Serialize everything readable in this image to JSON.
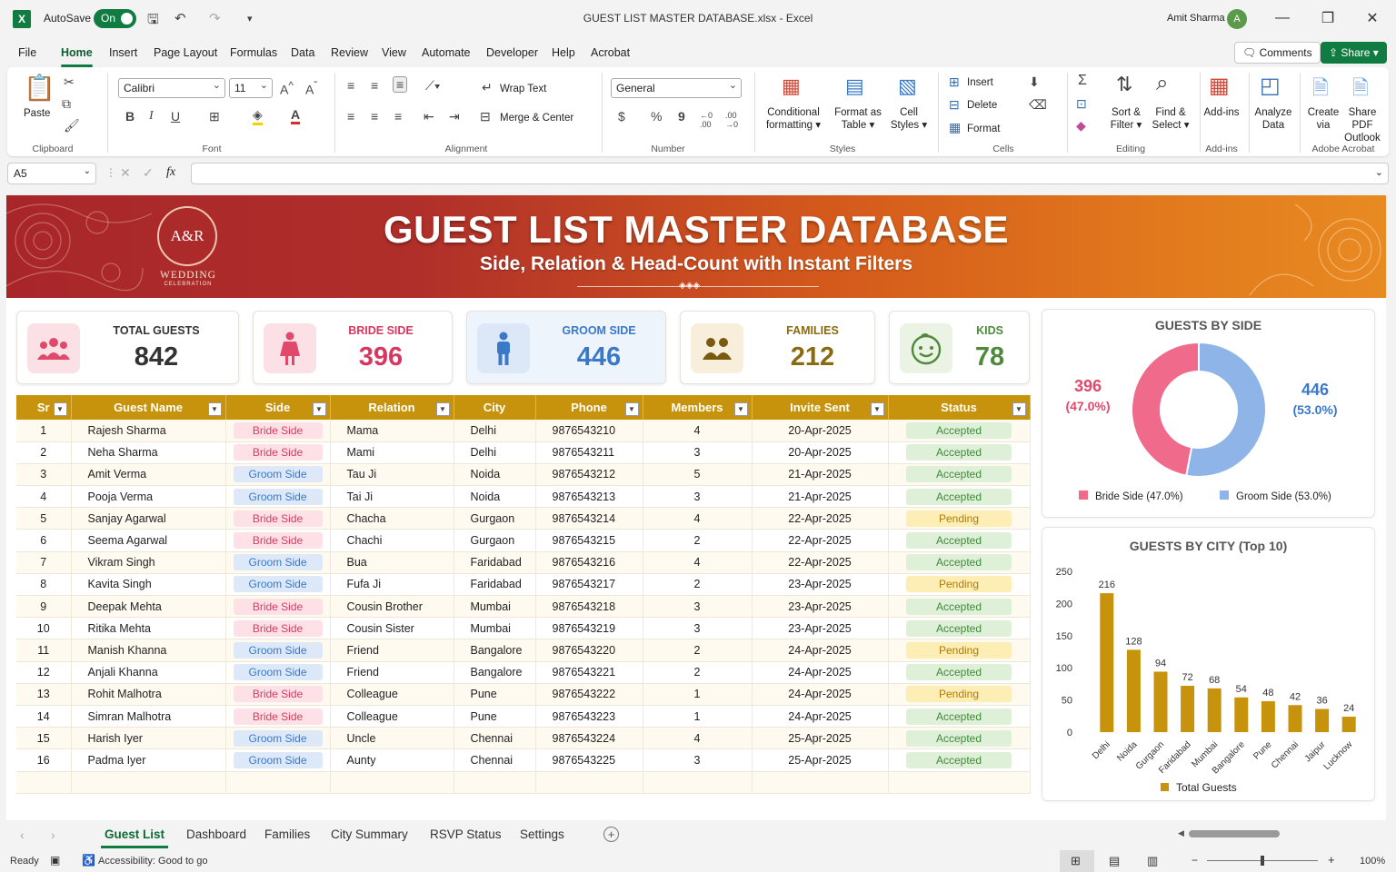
{
  "window": {
    "title": "GUEST LIST MASTER DATABASE.xlsx  -  Excel",
    "autosave_label": "AutoSave",
    "autosave_state": "On",
    "user_name": "Amit Sharma",
    "user_initial": "A"
  },
  "menu": [
    "File",
    "Home",
    "Insert",
    "Page Layout",
    "Formulas",
    "Data",
    "Review",
    "View",
    "Automate",
    "Developer",
    "Help",
    "Acrobat"
  ],
  "menu_active": "Home",
  "comments_label": "Comments",
  "share_label": "Share",
  "ribbon": {
    "clipboard": {
      "paste": "Paste",
      "label": "Clipboard"
    },
    "font": {
      "family": "Calibri",
      "size": "11",
      "label": "Font",
      "b": "B",
      "i": "I",
      "u": "U"
    },
    "alignment": {
      "wrap": "Wrap Text",
      "merge": "Merge & Center",
      "label": "Alignment"
    },
    "number": {
      "format": "General",
      "label": "Number",
      "currency": "$",
      "percent": "%",
      "comma": "9",
      "inc": "←0 .00",
      "dec": ".00 →0"
    },
    "styles": {
      "cond1": "Conditional",
      "cond2": "formatting",
      "fmt1": "Format as",
      "fmt2": "Table",
      "cell1": "Cell",
      "cell2": "Styles",
      "label": "Styles"
    },
    "cells": {
      "insert": "Insert",
      "delete": "Delete",
      "format": "Format",
      "label": "Cells"
    },
    "editing": {
      "sort1": "Sort &",
      "sort2": "Filter",
      "find1": "Find &",
      "find2": "Select",
      "label": "Editing"
    },
    "addins": {
      "btn": "Add-ins",
      "label": "Add-ins"
    },
    "analyze": {
      "l1": "Analyze",
      "l2": "Data"
    },
    "acrobat": {
      "c1": "Create",
      "c2": "via",
      "s1": "Share PDF",
      "s2": "Outlook",
      "label": "Adobe Acrobat"
    }
  },
  "formula_bar": {
    "cell_ref": "A5",
    "fx": "fx",
    "value": ""
  },
  "banner": {
    "title": "GUEST LIST MASTER DATABASE",
    "subtitle": "Side, Relation & Head-Count with Instant Filters",
    "monogram": "A&R",
    "wedding": "WEDDING",
    "celebration": "CELEBRATION"
  },
  "kpis": [
    {
      "label": "TOTAL GUESTS",
      "value": "842",
      "color": "#333333",
      "label_color": "#333333"
    },
    {
      "label": "BRIDE SIDE",
      "value": "396",
      "color": "#d8385f",
      "label_color": "#d8385f"
    },
    {
      "label": "GROOM SIDE",
      "value": "446",
      "color": "#3a78c8",
      "label_color": "#3a78c8"
    },
    {
      "label": "FAMILIES",
      "value": "212",
      "color": "#8a6a10",
      "label_color": "#8a6a10"
    },
    {
      "label": "KIDS",
      "value": "78",
      "color": "#4e8a3a",
      "label_color": "#4e8a3a"
    }
  ],
  "table": {
    "headers": [
      "Sr",
      "Guest Name",
      "Side",
      "Relation",
      "City",
      "Phone",
      "Members",
      "Invite Sent",
      "Status"
    ],
    "rows": [
      [
        "1",
        "Rajesh Sharma",
        "Bride Side",
        "Mama",
        "Delhi",
        "9876543210",
        "4",
        "20-Apr-2025",
        "Accepted"
      ],
      [
        "2",
        "Neha Sharma",
        "Bride Side",
        "Mami",
        "Delhi",
        "9876543211",
        "3",
        "20-Apr-2025",
        "Accepted"
      ],
      [
        "3",
        "Amit Verma",
        "Groom Side",
        "Tau Ji",
        "Noida",
        "9876543212",
        "5",
        "21-Apr-2025",
        "Accepted"
      ],
      [
        "4",
        "Pooja Verma",
        "Groom Side",
        "Tai Ji",
        "Noida",
        "9876543213",
        "3",
        "21-Apr-2025",
        "Accepted"
      ],
      [
        "5",
        "Sanjay Agarwal",
        "Bride Side",
        "Chacha",
        "Gurgaon",
        "9876543214",
        "4",
        "22-Apr-2025",
        "Pending"
      ],
      [
        "6",
        "Seema Agarwal",
        "Bride Side",
        "Chachi",
        "Gurgaon",
        "9876543215",
        "2",
        "22-Apr-2025",
        "Accepted"
      ],
      [
        "7",
        "Vikram Singh",
        "Groom Side",
        "Bua",
        "Faridabad",
        "9876543216",
        "4",
        "22-Apr-2025",
        "Accepted"
      ],
      [
        "8",
        "Kavita Singh",
        "Groom Side",
        "Fufa Ji",
        "Faridabad",
        "9876543217",
        "2",
        "23-Apr-2025",
        "Pending"
      ],
      [
        "9",
        "Deepak Mehta",
        "Bride Side",
        "Cousin Brother",
        "Mumbai",
        "9876543218",
        "3",
        "23-Apr-2025",
        "Accepted"
      ],
      [
        "10",
        "Ritika Mehta",
        "Bride Side",
        "Cousin Sister",
        "Mumbai",
        "9876543219",
        "3",
        "23-Apr-2025",
        "Accepted"
      ],
      [
        "11",
        "Manish Khanna",
        "Groom Side",
        "Friend",
        "Bangalore",
        "9876543220",
        "2",
        "24-Apr-2025",
        "Pending"
      ],
      [
        "12",
        "Anjali Khanna",
        "Groom Side",
        "Friend",
        "Bangalore",
        "9876543221",
        "2",
        "24-Apr-2025",
        "Accepted"
      ],
      [
        "13",
        "Rohit Malhotra",
        "Bride Side",
        "Colleague",
        "Pune",
        "9876543222",
        "1",
        "24-Apr-2025",
        "Pending"
      ],
      [
        "14",
        "Simran Malhotra",
        "Bride Side",
        "Colleague",
        "Pune",
        "9876543223",
        "1",
        "24-Apr-2025",
        "Accepted"
      ],
      [
        "15",
        "Harish Iyer",
        "Groom Side",
        "Uncle",
        "Chennai",
        "9876543224",
        "4",
        "25-Apr-2025",
        "Accepted"
      ],
      [
        "16",
        "Padma Iyer",
        "Groom Side",
        "Aunty",
        "Chennai",
        "9876543225",
        "3",
        "25-Apr-2025",
        "Accepted"
      ]
    ]
  },
  "chart_data": [
    {
      "type": "pie",
      "title": "GUESTS BY SIDE",
      "labels": [
        "Bride Side (47.0%)",
        "Groom Side (53.0%)"
      ],
      "values": [
        396,
        446
      ],
      "value_labels": [
        "396",
        "446"
      ],
      "pct_labels": [
        "(47.0%)",
        "(53.0%)"
      ],
      "colors": [
        "#f06a8c",
        "#8fb4e8"
      ],
      "donut": true
    },
    {
      "type": "bar",
      "title": "GUESTS BY CITY (Top 10)",
      "categories": [
        "Delhi",
        "Noida",
        "Gurgaon",
        "Faridabad",
        "Mumbai",
        "Bangalore",
        "Pune",
        "Chennai",
        "Jaipur",
        "Lucknow"
      ],
      "series": [
        {
          "name": "Total Guests",
          "values": [
            216,
            128,
            94,
            72,
            68,
            54,
            48,
            42,
            36,
            24
          ],
          "color": "#c8930c"
        }
      ],
      "ylim": [
        0,
        250
      ],
      "yticks": [
        "0",
        "50",
        "100",
        "150",
        "200",
        "250"
      ]
    }
  ],
  "sheet_tabs": [
    "Guest List",
    "Dashboard",
    "Families",
    "City Summary",
    "RSVP Status",
    "Settings"
  ],
  "active_tab": "Guest List",
  "status": {
    "ready": "Ready",
    "accessibility": "Accessibility: Good to go",
    "zoom": "100%"
  }
}
